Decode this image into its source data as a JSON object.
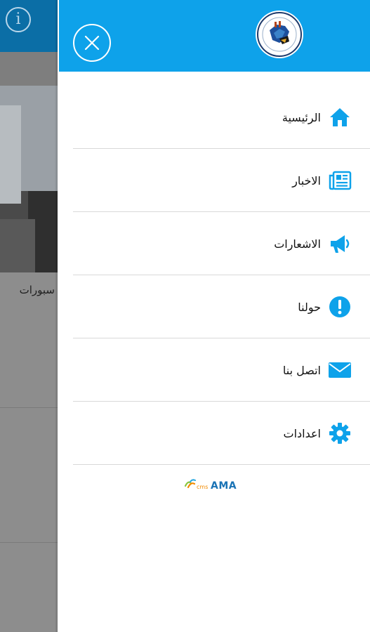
{
  "background": {
    "info_icon_glyph": "i",
    "caption": "سبورات"
  },
  "drawer": {
    "colors": {
      "header": "#0ea2ea",
      "icon": "#0ea2ea"
    },
    "menu": [
      {
        "label": "الرئيسية",
        "icon": "home-icon"
      },
      {
        "label": "الاخبار",
        "icon": "newspaper-icon"
      },
      {
        "label": "الاشعارات",
        "icon": "megaphone-icon"
      },
      {
        "label": "حولنا",
        "icon": "exclamation-icon"
      },
      {
        "label": "اتصل بنا",
        "icon": "envelope-icon"
      },
      {
        "label": "اعدادات",
        "icon": "gear-icon"
      }
    ],
    "brand": {
      "prefix": "cms",
      "name": "AMA"
    }
  }
}
